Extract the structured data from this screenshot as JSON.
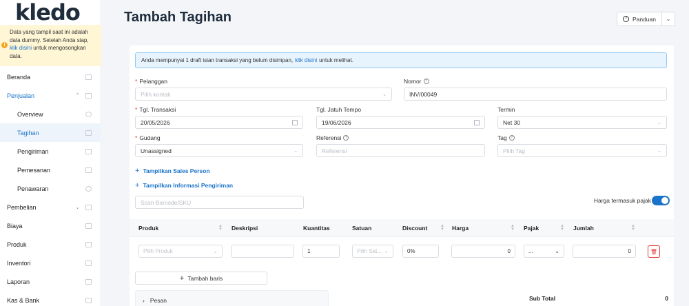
{
  "sidebar": {
    "logo": "kledo",
    "notice": {
      "text_before": "Data yang tampil saat ini adalah data dummy. Setelah Anda siap,",
      "link": "klik disini",
      "text_after": "untuk mengosongkan data."
    },
    "items": [
      {
        "label": "Beranda",
        "icon": "home-icon"
      },
      {
        "label": "Penjualan",
        "icon": "basket-icon"
      },
      {
        "label": "Overview",
        "icon": "chart-icon"
      },
      {
        "label": "Tagihan",
        "icon": "invoice-icon"
      },
      {
        "label": "Pengiriman",
        "icon": "truck-icon"
      },
      {
        "label": "Pemesanan",
        "icon": "order-icon"
      },
      {
        "label": "Penawaran",
        "icon": "quote-icon"
      },
      {
        "label": "Pembelian",
        "icon": "bag-icon"
      },
      {
        "label": "Biaya",
        "icon": "card-icon"
      },
      {
        "label": "Produk",
        "icon": "box-icon"
      },
      {
        "label": "Inventori",
        "icon": "inventory-icon"
      },
      {
        "label": "Laporan",
        "icon": "report-icon"
      },
      {
        "label": "Kas & Bank",
        "icon": "bank-icon"
      }
    ]
  },
  "header": {
    "title": "Tambah Tagihan",
    "guide_button": "Panduan"
  },
  "form": {
    "draft_notice": {
      "text_before": "Anda mempunyai 1 draft isian transaksi yang belum disimpan,",
      "link": "klik disini",
      "text_after": "untuk melihat."
    },
    "pelanggan": {
      "label": "Pelanggan",
      "placeholder": "Pilih kontak"
    },
    "nomor": {
      "label": "Nomor",
      "value": "INV/00049"
    },
    "tgl_transaksi": {
      "label": "Tgl. Transaksi",
      "value": "20/05/2026"
    },
    "tgl_jatuh_tempo": {
      "label": "Tgl. Jatuh Tempo",
      "value": "19/06/2026"
    },
    "termin": {
      "label": "Termin",
      "value": "Net 30"
    },
    "gudang": {
      "label": "Gudang",
      "value": "Unassigned"
    },
    "referensi": {
      "label": "Referensi",
      "placeholder": "Referensi"
    },
    "tag": {
      "label": "Tag",
      "placeholder": "Pilih Tag"
    },
    "show_sales_person": "Tampilkan Sales Person",
    "show_shipping_info": "Tampilkan Informasi Pengiriman",
    "scan_placeholder": "Scan Barcode/SKU",
    "tax_inclusive_label": "Harga termasuk pajak",
    "tax_inclusive": true
  },
  "table": {
    "columns": [
      "Produk",
      "Deskripsi",
      "Kuantitas",
      "Satuan",
      "Discount",
      "Harga",
      "Pajak",
      "Jumlah"
    ],
    "row": {
      "produk_placeholder": "Pilih Produk",
      "deskripsi": "",
      "kuantitas": "1",
      "satuan_placeholder": "Pilih Sat...",
      "discount": "0%",
      "harga": "0",
      "pajak": "...",
      "jumlah": "0"
    },
    "add_row": "Tambah baris"
  },
  "footer": {
    "pesan": "Pesan",
    "subtotal_label": "Sub Total",
    "subtotal_value": "0"
  },
  "colors": {
    "accent": "#1a73c8",
    "danger": "#e53935",
    "notice_bg": "#fff6d6"
  }
}
